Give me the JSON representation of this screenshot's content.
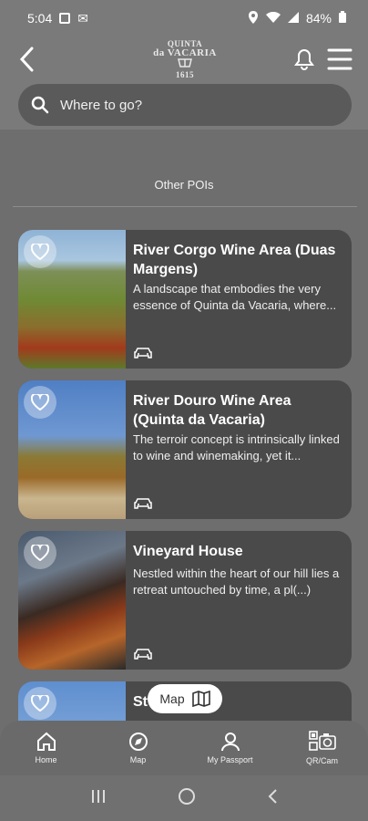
{
  "status": {
    "time": "5:04",
    "battery": "84%"
  },
  "header": {
    "logo_line1": "QUINTA",
    "logo_line2": "da VACARIA",
    "logo_line3": "1615"
  },
  "search": {
    "placeholder": "Where to go?"
  },
  "section": {
    "title": "Other POIs"
  },
  "pois": [
    {
      "title": "River Corgo Wine Area (Duas Margens)",
      "description": "A landscape that embodies the very essence of Quinta da Vacaria, where...",
      "icon": "car-icon"
    },
    {
      "title": "River Douro Wine Area (Quinta da Vacaria)",
      "description": "The terroir concept is intrinsically linked to wine and winemaking, yet it...",
      "icon": "car-icon"
    },
    {
      "title": "Vineyard House",
      "description": "Nestled within the heart of our hill lies a retreat untouched by time, a pl(...)",
      "icon": "car-icon"
    },
    {
      "title": "St",
      "description": "",
      "icon": "car-icon"
    }
  ],
  "map_button": {
    "label": "Map"
  },
  "bottom_nav": {
    "items": [
      {
        "label": "Home",
        "icon": "home-icon"
      },
      {
        "label": "Map",
        "icon": "compass-icon"
      },
      {
        "label": "My Passport",
        "icon": "person-icon"
      },
      {
        "label": "QR/Cam",
        "icon": "qr-camera-icon"
      }
    ]
  },
  "colors": {
    "background": "#6e6e6e",
    "card": "#4a4a4a",
    "search": "#5a5a5a",
    "map_button": "#ffffff"
  }
}
